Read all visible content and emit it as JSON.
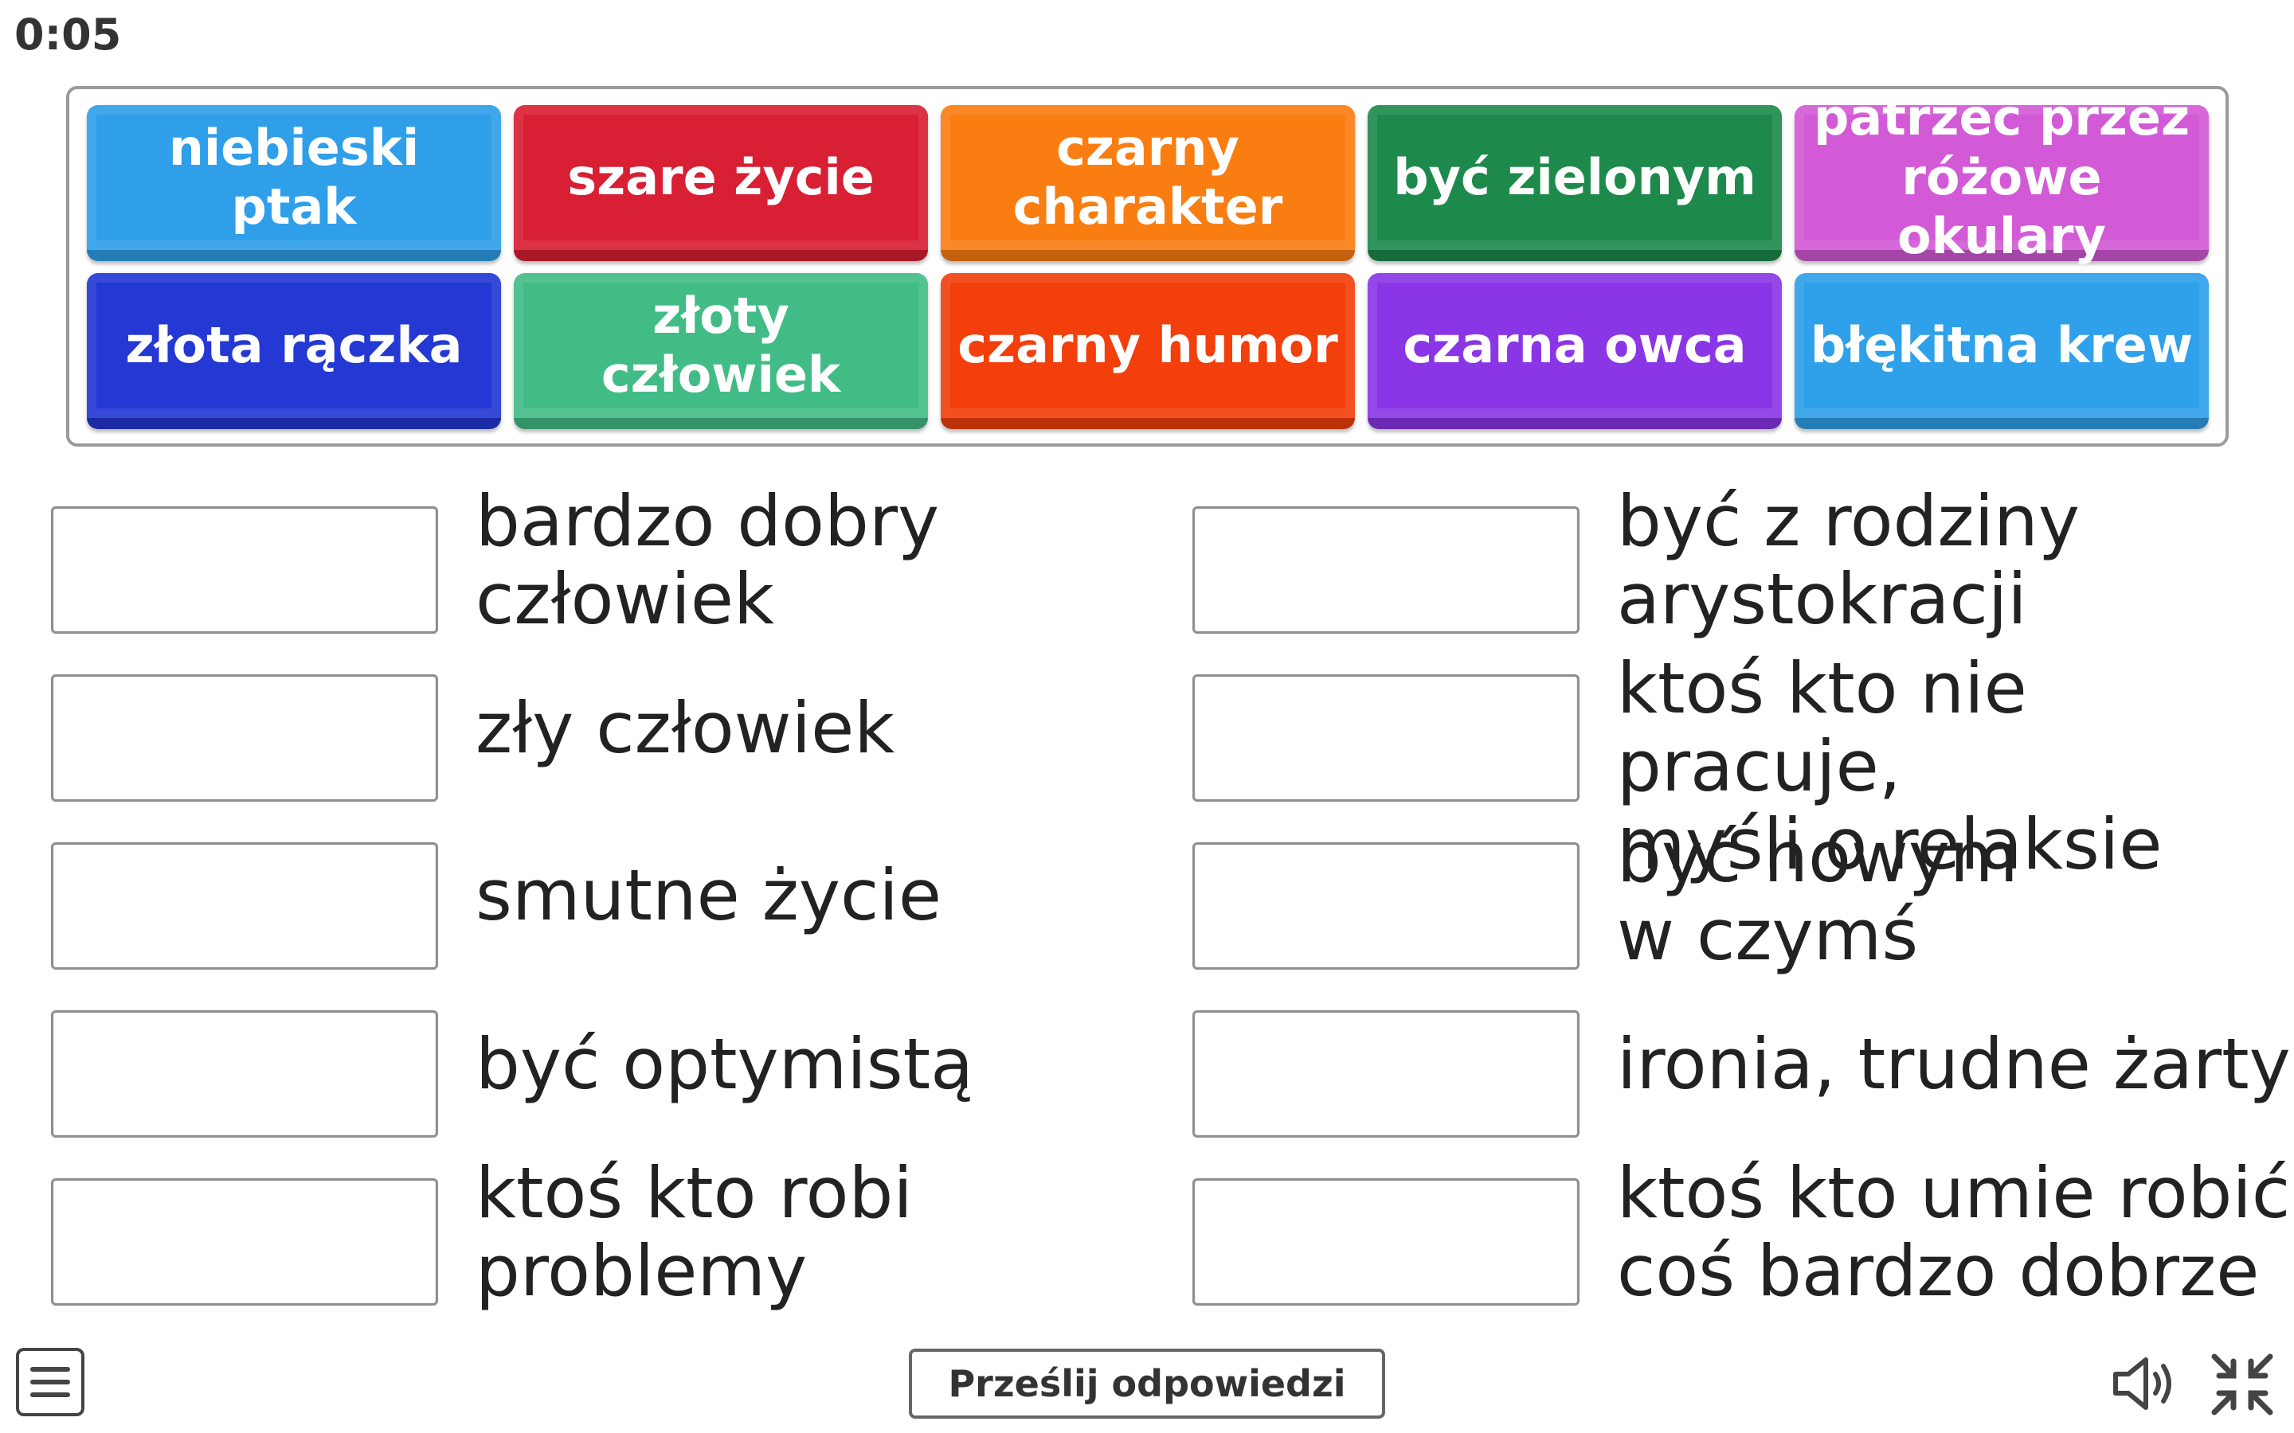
{
  "timer": "0:05",
  "tiles": [
    {
      "label": "niebieski ptak",
      "color": "#2f9fea"
    },
    {
      "label": "szare życie",
      "color": "#d81f33"
    },
    {
      "label": "czarny charakter",
      "color": "#fa7d12"
    },
    {
      "label": "być zielonym",
      "color": "#1d8a4c"
    },
    {
      "label": "patrzeć przez różowe okulary",
      "color": "#d35ad6"
    },
    {
      "label": "złota rączka",
      "color": "#2438d4"
    },
    {
      "label": "złoty człowiek",
      "color": "#42bc86"
    },
    {
      "label": "czarny humor",
      "color": "#f23f0c"
    },
    {
      "label": "czarna owca",
      "color": "#8a36e6"
    },
    {
      "label": "błękitna krew",
      "color": "#2fa0ea"
    }
  ],
  "clues_left": [
    "bardzo dobry\nczłowiek",
    "zły człowiek",
    "smutne życie",
    "być optymistą",
    "ktoś kto robi\nproblemy"
  ],
  "clues_right": [
    "być z rodziny\narystokracji",
    "ktoś kto nie pracuje,\nmyśli o relaksie",
    "być nowym\nw czymś",
    "ironia, trudne żarty",
    "ktoś kto umie robić\ncoś bardzo dobrze"
  ],
  "submit_label": "Prześlij odpowiedzi",
  "icons": {
    "menu": "menu-icon",
    "sound": "speaker-icon",
    "fullscreen": "exit-fullscreen-icon"
  }
}
